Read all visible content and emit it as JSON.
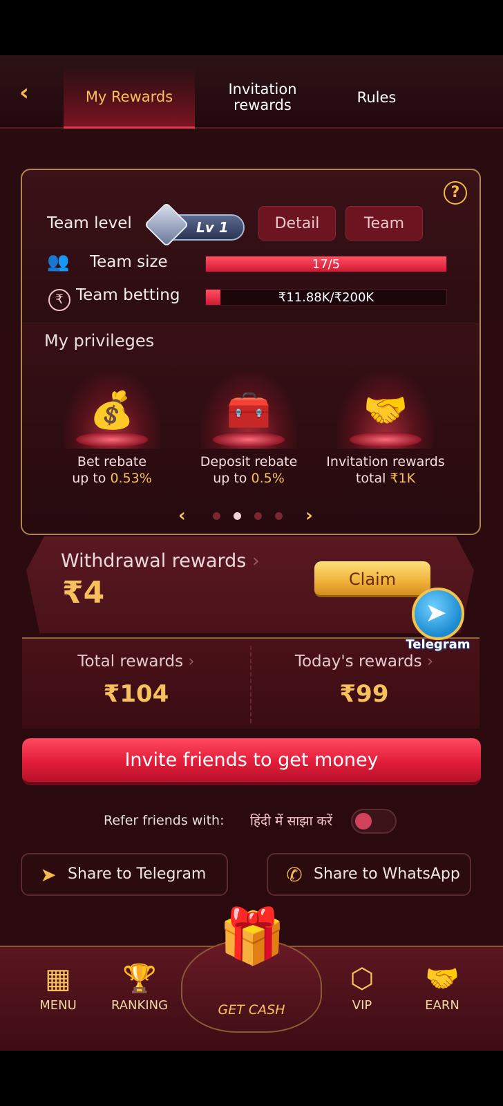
{
  "header": {
    "tabs": [
      {
        "label": "My Rewards"
      },
      {
        "label": "Invitation rewards"
      },
      {
        "label": "Rules"
      }
    ]
  },
  "team": {
    "level_label": "Team level",
    "level_badge": "Lv 1",
    "detail_button": "Detail",
    "team_button": "Team",
    "size_label": "Team size",
    "size_value": "17/5",
    "size_progress": 1.0,
    "betting_label": "Team betting",
    "betting_value": "₹11.88K/₹200K",
    "betting_progress": 0.06
  },
  "privileges": {
    "title": "My privileges",
    "items": [
      {
        "line1": "Bet rebate",
        "prefix": "up to ",
        "value": "0.53%"
      },
      {
        "line1": "Deposit rebate",
        "prefix": "up to ",
        "value": "0.5%"
      },
      {
        "line1": "Invitation rewards",
        "prefix": "total ",
        "value": "₹1K"
      }
    ],
    "page_index": 1,
    "page_count": 4
  },
  "withdrawal": {
    "title": "Withdrawal rewards",
    "amount": "₹4",
    "claim_button": "Claim"
  },
  "floating": {
    "telegram_label": "Telegram"
  },
  "totals": {
    "total_label": "Total rewards",
    "total_value": "₹104",
    "today_label": "Today's rewards",
    "today_value": "₹99"
  },
  "invite_button": "Invite friends to get money",
  "refer": {
    "label": "Refer friends with:",
    "hindi": "हिंदी में साझा करें"
  },
  "share": {
    "telegram": "Share to Telegram",
    "whatsapp": "Share to WhatsApp"
  },
  "nav": {
    "menu": "MENU",
    "ranking": "RANKING",
    "get_cash": "GET CASH",
    "vip": "VIP",
    "earn": "EARN"
  }
}
